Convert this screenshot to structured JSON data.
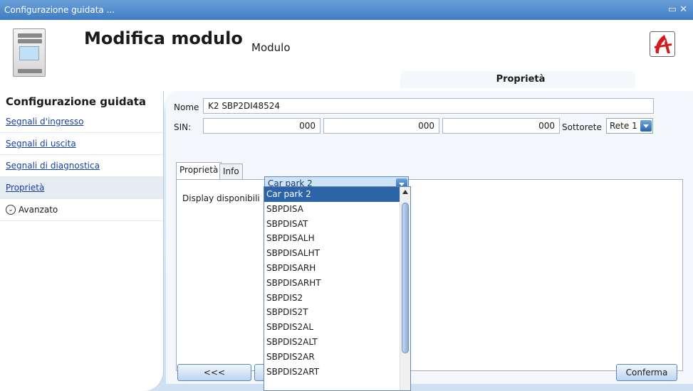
{
  "window": {
    "title": "Configurazione guidata ..."
  },
  "header": {
    "title": "Modifica modulo",
    "subtitle": "Modulo",
    "properties_tab": "Proprietà"
  },
  "sidebar": {
    "heading": "Configurazione guidata",
    "items": [
      {
        "label": "Segnali d'ingresso"
      },
      {
        "label": "Segnali di uscita"
      },
      {
        "label": "Segnali di diagnostica"
      },
      {
        "label": "Proprietà"
      },
      {
        "label": "Avanzato"
      }
    ]
  },
  "form": {
    "name_label": "Nome",
    "name_value": "K2 SBP2DI48524",
    "sin_label": "SIN:",
    "sin_values": [
      "000",
      "000",
      "000"
    ],
    "subnet_label": "Sottorete",
    "subnet_value": "Rete 1"
  },
  "tabs": [
    {
      "label": "Proprietà"
    },
    {
      "label": "Info"
    }
  ],
  "display": {
    "label": "Display disponibili",
    "selected": "Car park 2",
    "options": [
      "Car park 2",
      "SBPDISA",
      "SBPDISAT",
      "SBPDISALH",
      "SBPDISALHT",
      "SBPDISARH",
      "SBPDISARHT",
      "SBPDIS2",
      "SBPDIS2T",
      "SBPDIS2AL",
      "SBPDIS2ALT",
      "SBPDIS2AR",
      "SBPDIS2ART"
    ]
  },
  "buttons": {
    "back": "<<<",
    "confirm": "Conferma"
  }
}
